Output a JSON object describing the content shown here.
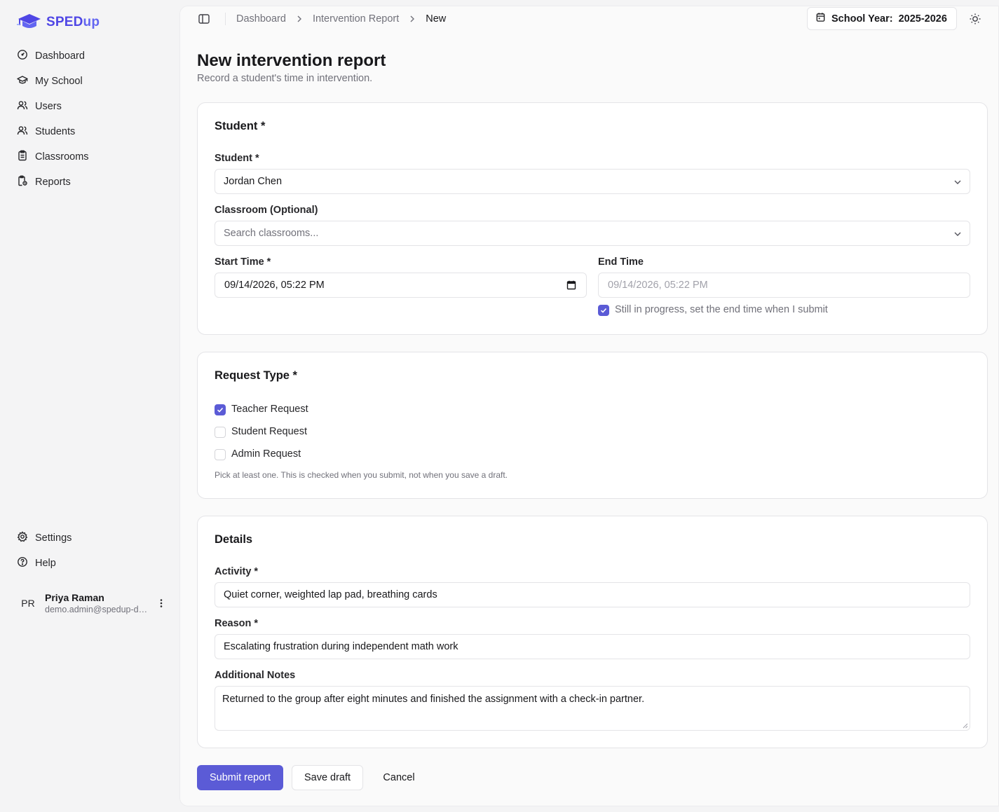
{
  "brand": {
    "name_main": "SPED",
    "name_suffix": "up",
    "accent": "#5b5bd6"
  },
  "nav": {
    "items": [
      {
        "label": "Dashboard",
        "icon": "gauge-icon"
      },
      {
        "label": "My School",
        "icon": "graduation-cap-icon"
      },
      {
        "label": "Users",
        "icon": "users-icon"
      },
      {
        "label": "Students",
        "icon": "students-icon"
      },
      {
        "label": "Classrooms",
        "icon": "clipboard-icon"
      },
      {
        "label": "Reports",
        "icon": "report-icon"
      }
    ],
    "bottom": [
      {
        "label": "Settings",
        "icon": "gear-icon"
      },
      {
        "label": "Help",
        "icon": "help-icon"
      }
    ]
  },
  "user": {
    "initials": "PR",
    "name": "Priya Raman",
    "email": "demo.admin@spedup-demo.org"
  },
  "topbar": {
    "breadcrumb": [
      "Dashboard",
      "Intervention Report",
      "New"
    ],
    "school_year_label": "School Year:",
    "school_year_value": "2025-2026"
  },
  "page": {
    "title": "New intervention report",
    "subtitle": "Record a student's time in intervention."
  },
  "student_card": {
    "title": "Student *",
    "student_label": "Student *",
    "student_value": "Jordan Chen",
    "classroom_label": "Classroom (Optional)",
    "classroom_placeholder": "Search classrooms...",
    "start_label": "Start Time *",
    "start_value": "09/14/2026, 05:22 PM",
    "end_label": "End Time",
    "end_value": "09/14/2026, 05:22 PM",
    "in_progress_label": "Still in progress, set the end time when I submit",
    "in_progress_checked": true
  },
  "request_card": {
    "title": "Request Type *",
    "options": [
      {
        "label": "Teacher Request",
        "checked": true
      },
      {
        "label": "Student Request",
        "checked": false
      },
      {
        "label": "Admin Request",
        "checked": false
      }
    ],
    "hint": "Pick at least one. This is checked when you submit, not when you save a draft."
  },
  "details_card": {
    "title": "Details",
    "activity_label": "Activity *",
    "activity_value": "Quiet corner, weighted lap pad, breathing cards",
    "reason_label": "Reason *",
    "reason_value": "Escalating frustration during independent math work",
    "notes_label": "Additional Notes",
    "notes_value": "Returned to the group after eight minutes and finished the assignment with a check-in partner."
  },
  "actions": {
    "submit": "Submit report",
    "save_draft": "Save draft",
    "cancel": "Cancel"
  }
}
